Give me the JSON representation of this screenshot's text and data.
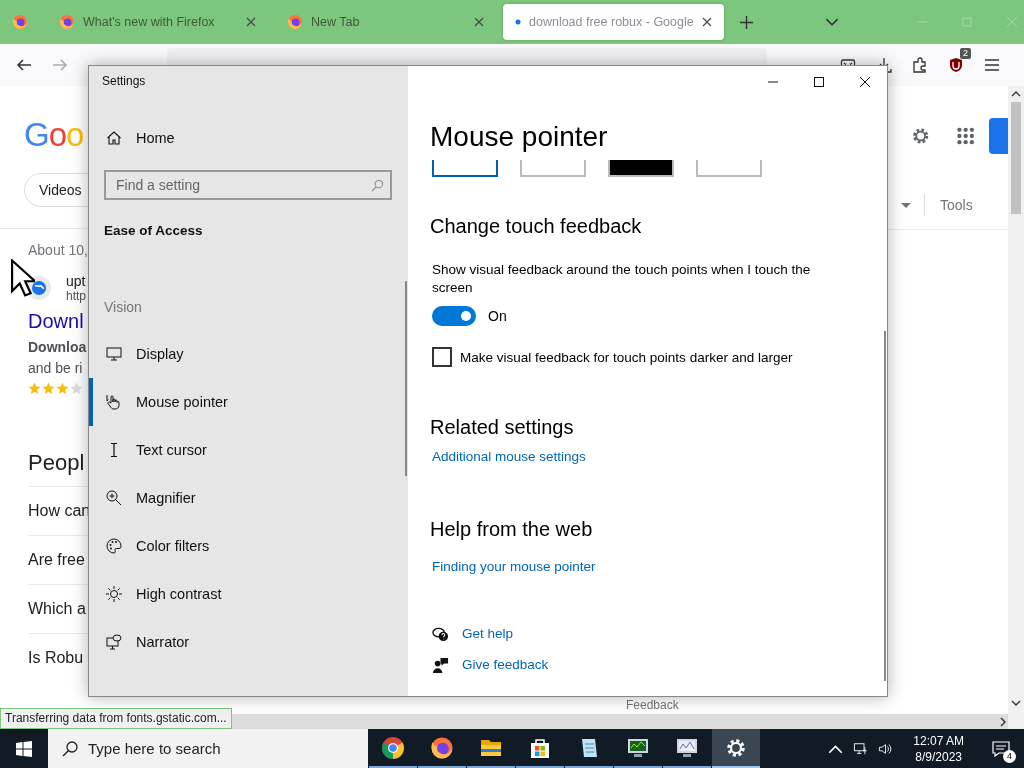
{
  "browser": {
    "tabs": [
      {
        "kind": "pinned",
        "selected": false
      },
      {
        "kind": "page",
        "title": "What's new with Firefox",
        "selected": false
      },
      {
        "kind": "page",
        "title": "New Tab",
        "selected": false
      },
      {
        "kind": "loading",
        "title": "download free robux - Google",
        "selected": true
      }
    ],
    "extension_badge": "2",
    "page": {
      "logo": "Goo",
      "chip": "Videos",
      "result_stats": "About 10,",
      "result": {
        "site": "upt",
        "url": "http",
        "title": "Downl",
        "snippet_bold": "Downloa",
        "snippet": "and be ri",
        "stars": 3
      },
      "question_heading": "Peopl",
      "questions": [
        "How can",
        "Are free",
        "Which a",
        "Is Robu"
      ],
      "tools": "Tools",
      "footer": "Feedback"
    },
    "status": "Transferring data from fonts.gstatic.com..."
  },
  "settings": {
    "title": "Settings",
    "home": "Home",
    "search": {
      "placeholder": "Find a setting"
    },
    "section": "Ease of Access",
    "group": "Vision",
    "items": [
      {
        "kind": "display",
        "label": "Display",
        "selected": false
      },
      {
        "kind": "pointer",
        "label": "Mouse pointer",
        "selected": true
      },
      {
        "kind": "text_cursor",
        "label": "Text cursor",
        "selected": false
      },
      {
        "kind": "magnifier",
        "label": "Magnifier",
        "selected": false
      },
      {
        "kind": "color_filters",
        "label": "Color filters",
        "selected": false
      },
      {
        "kind": "high_contrast",
        "label": "High contrast",
        "selected": false
      },
      {
        "kind": "narrator",
        "label": "Narrator",
        "selected": false
      }
    ],
    "content": {
      "heading": "Mouse pointer",
      "swatches": [
        {
          "color": "#ffffff",
          "selected": true
        },
        {
          "color": "#ffffff",
          "selected": false
        },
        {
          "color": "#000000",
          "selected": false
        },
        {
          "color": "#ffffff",
          "selected": false
        }
      ],
      "touch_heading": "Change touch feedback",
      "touch_description": "Show visual feedback around the touch points when I touch the screen",
      "toggle": {
        "on": true,
        "label": "On"
      },
      "checkbox": {
        "checked": false,
        "label": "Make visual feedback for touch points darker and larger"
      },
      "related_heading": "Related settings",
      "related_link": "Additional mouse settings",
      "help_heading": "Help from the web",
      "help_link": "Finding your mouse pointer",
      "get_help": "Get help",
      "give_feedback": "Give feedback"
    }
  },
  "taskbar": {
    "search": {
      "placeholder": "Type here to search"
    },
    "apps": [
      {
        "kind": "chrome",
        "selected": false
      },
      {
        "kind": "firefox",
        "selected": false
      },
      {
        "kind": "folder",
        "selected": false
      },
      {
        "kind": "store",
        "selected": false
      },
      {
        "kind": "notepad",
        "selected": false
      },
      {
        "kind": "monitor",
        "selected": false
      },
      {
        "kind": "graph",
        "selected": false
      },
      {
        "kind": "settings",
        "selected": true
      }
    ],
    "time": "12:07 AM",
    "date": "8/9/2023",
    "notifications": "4"
  }
}
